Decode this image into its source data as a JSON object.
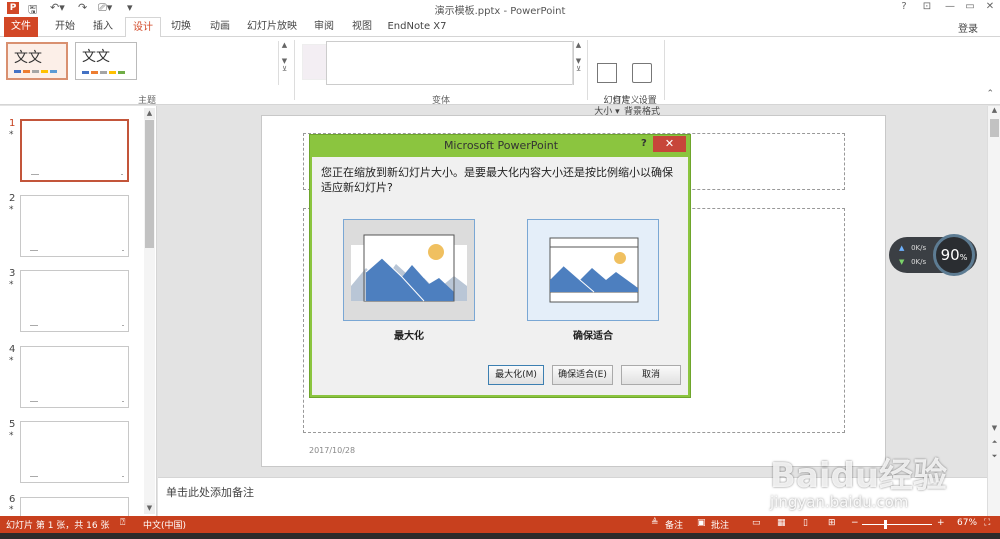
{
  "window": {
    "title": "演示模板.pptx - PowerPoint",
    "controls": [
      "?",
      "⊡",
      "—",
      "▭",
      "✕"
    ],
    "login": "登录"
  },
  "tabs": [
    {
      "label": "文件"
    },
    {
      "label": "开始"
    },
    {
      "label": "插入"
    },
    {
      "label": "设计"
    },
    {
      "label": "切换"
    },
    {
      "label": "动画"
    },
    {
      "label": "幻灯片放映"
    },
    {
      "label": "审阅"
    },
    {
      "label": "视图"
    },
    {
      "label": "EndNote X7"
    }
  ],
  "ribbon": {
    "themes": [
      {
        "text": "文文"
      },
      {
        "text": "文文"
      }
    ],
    "groups": {
      "themes": "主题",
      "variants": "变体",
      "customize": "自定义"
    },
    "commands": {
      "slide_size": "幻灯片\n大小 ▾",
      "format_background": "设置\n背景格式"
    }
  },
  "slides": [
    {
      "num": "1",
      "star": "*"
    },
    {
      "num": "2",
      "star": "*"
    },
    {
      "num": "3",
      "star": "*"
    },
    {
      "num": "4",
      "star": "*"
    },
    {
      "num": "5",
      "star": "*"
    },
    {
      "num": "6",
      "star": "*"
    }
  ],
  "slide": {
    "date": "2017/10/28"
  },
  "notes_placeholder": "单击此处添加备注",
  "network_widget": {
    "up": "0K/s",
    "down": "0K/s",
    "percent": "90",
    "unit": "%"
  },
  "dialog": {
    "title": "Microsoft PowerPoint",
    "help": "?",
    "close": "✕",
    "message": "您正在缩放到新幻灯片大小。是要最大化内容大小还是按比例缩小以确保适应新幻灯片?",
    "option_maximize": "最大化",
    "option_ensure_fit": "确保适合",
    "btn_maximize": "最大化(M)",
    "btn_ensure_fit": "确保适合(E)",
    "btn_cancel": "取消"
  },
  "status": {
    "slide_info": "幻灯片 第 1 张，共 16 张",
    "language": "中文(中国)",
    "notes": "备注",
    "comments": "批注",
    "zoom": "67%"
  },
  "watermark": {
    "main": "Baidu经验",
    "sub": "jingyan.baidu.com"
  },
  "colors": {
    "accent": "#d24726",
    "dialog_frame": "#8bc53f",
    "status_bar": "#c8401e"
  }
}
